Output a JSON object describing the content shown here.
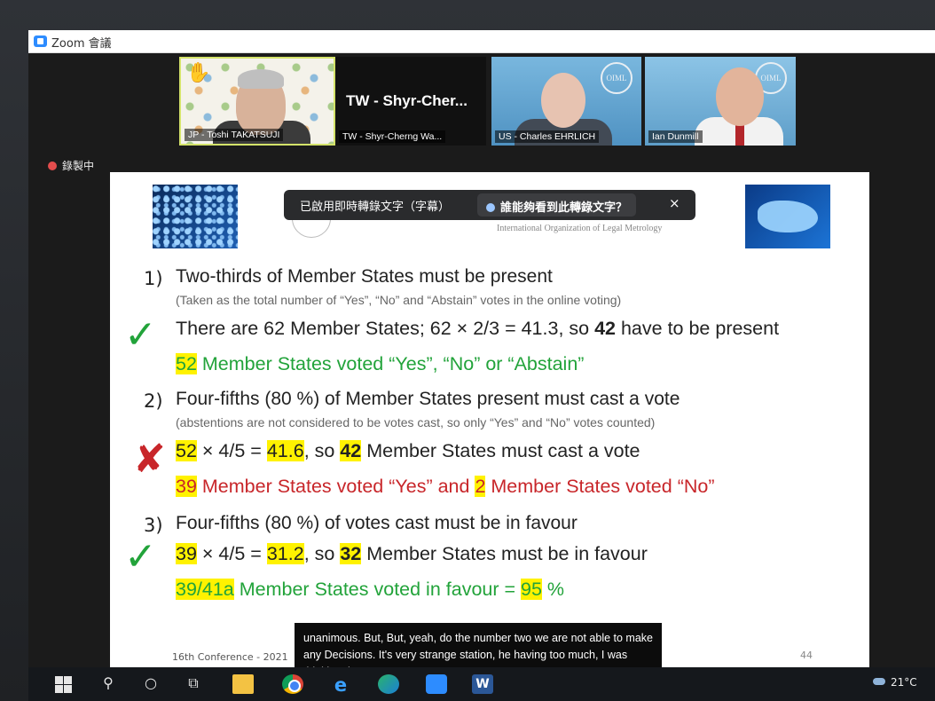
{
  "window": {
    "title": "Zoom 會議"
  },
  "participants": [
    {
      "name": "JP - Toshi TAKATSUJI"
    },
    {
      "name": "TW - Shyr-Cherng Wa...",
      "big_label": "TW - Shyr-Cher..."
    },
    {
      "name": "US - Charles EHRLICH",
      "logo": "OIML"
    },
    {
      "name": "Ian Dunmill",
      "logo": "OIML"
    }
  ],
  "recording": {
    "label": "錄製中"
  },
  "caption_banner": {
    "text": "已啟用即時轉錄文字（字幕）",
    "button": "誰能夠看到此轉錄文字？",
    "close": "×"
  },
  "slide": {
    "org_name": "International Organization of Legal Metrology",
    "item1": {
      "num": "1)",
      "heading": "Two-thirds of Member States must be present",
      "note": "(Taken as the total number of “Yes”, “No” and “Abstain” votes in the online voting)",
      "line_a_pre": "There are 62 Member States; 62 × 2/3 = 41.3, so ",
      "line_a_bold": "42",
      "line_a_post": " have to be present",
      "line_b_num": "52",
      "line_b_text": " Member States voted “Yes”, “No” or “Abstain”",
      "mark": "✓"
    },
    "item2": {
      "num": "2)",
      "heading": "Four-fifths (80 %) of Member States present must cast a vote",
      "note": "(abstentions are not considered to be votes cast, so only “Yes” and “No” votes counted)",
      "line_a_n1": "52",
      "line_a_mid": " × 4/5 = ",
      "line_a_n2": "41.6",
      "line_a_so": ", so ",
      "line_a_bold": "42",
      "line_a_post": " Member States must cast a vote",
      "line_b_n1": "39",
      "line_b_mid": " Member States voted “Yes” and ",
      "line_b_n2": "2",
      "line_b_post": " Member States voted “No”",
      "mark": "✘"
    },
    "item3": {
      "num": "3)",
      "heading": "Four-fifths (80 %) of votes cast must be in favour",
      "line_a_n1": "39",
      "line_a_mid": " × 4/5 = ",
      "line_a_n2": "31.2",
      "line_a_so": ", so ",
      "line_a_bold": "32",
      "line_a_post": " Member States must be in favour",
      "line_b_n1": "39/41a",
      "line_b_mid": " Member States voted in favour = ",
      "line_b_n2": "95",
      "line_b_post": " %",
      "mark": "✓"
    },
    "footer": "16th Conference - 2021",
    "page": "44"
  },
  "live_caption": {
    "text": "unanimous. But, But, yeah, do the number two we are not able to make any Decisions. It's very strange station, he having too much, I was thinking the same."
  },
  "taskbar": {
    "icons": [
      "windows-start-icon",
      "search-icon",
      "cortana-icon",
      "task-view-icon",
      "file-explorer-icon",
      "chrome-icon",
      "edge-legacy-icon",
      "edge-icon",
      "zoom-icon",
      "word-icon"
    ],
    "word_letter": "W",
    "weather": "21°C"
  },
  "colors": {
    "accent": "#2d8cff",
    "green": "#22a33a",
    "red": "#c8262a",
    "highlight": "#fff200"
  }
}
